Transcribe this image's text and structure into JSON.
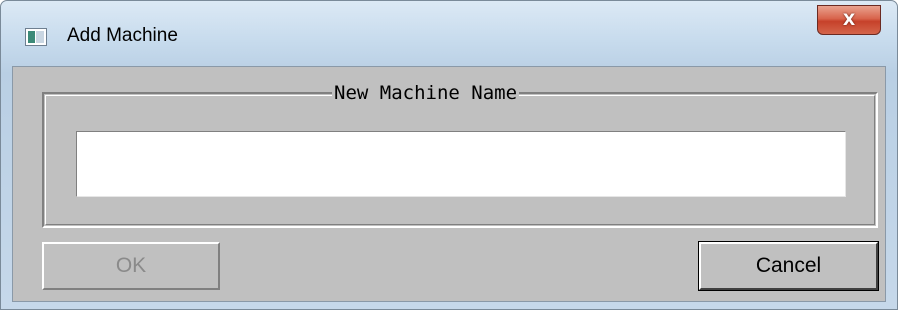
{
  "window": {
    "title": "Add Machine",
    "close_label": "X"
  },
  "dialog": {
    "group_label": "New Machine Name",
    "name_input": {
      "value": "",
      "placeholder": ""
    },
    "ok_label": "OK",
    "ok_enabled": false,
    "cancel_label": "Cancel"
  },
  "icons": {
    "app": "app-window-icon",
    "close": "close-icon"
  },
  "colors": {
    "dialog_background": "#c0c0c0",
    "title_gradient_top": "#dce9f5",
    "close_button": "#c6412a",
    "disabled_text": "#8a8a8a"
  }
}
